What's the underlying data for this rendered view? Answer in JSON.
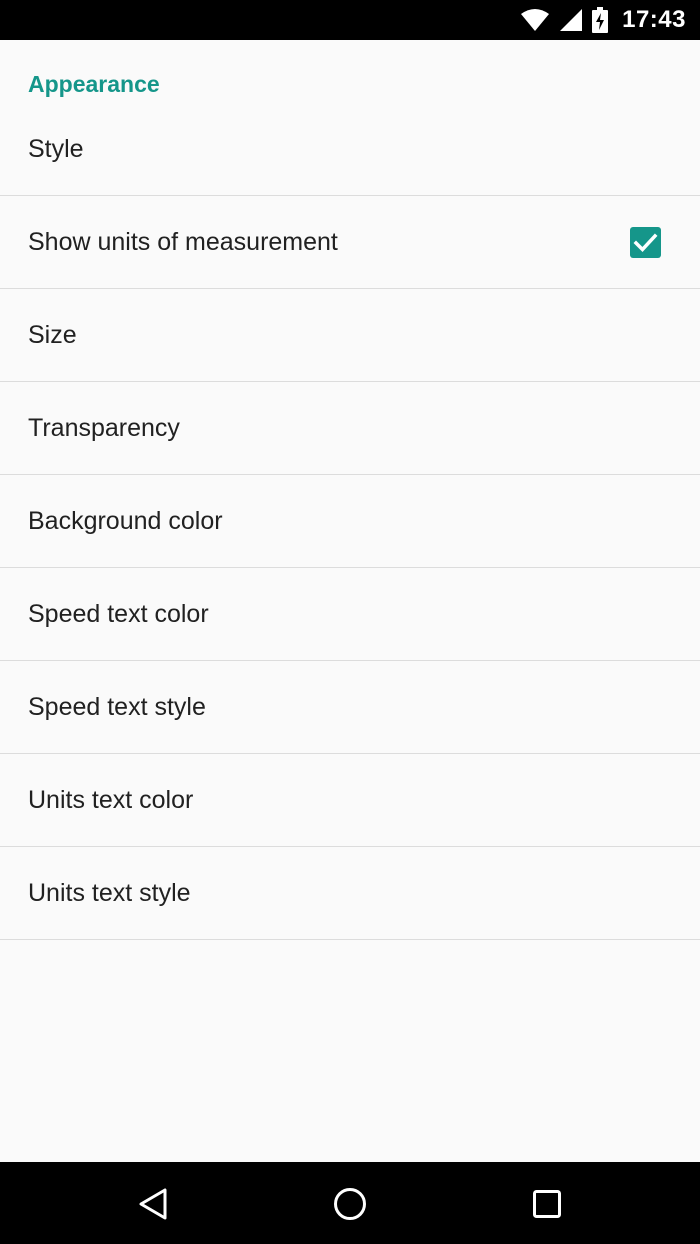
{
  "status_bar": {
    "time": "17:43",
    "icons": [
      "wifi-icon",
      "cell-signal-icon",
      "battery-charging-icon"
    ]
  },
  "settings": {
    "category_title": "Appearance",
    "items": [
      {
        "label": "Style"
      },
      {
        "label": "Show units of measurement",
        "checked": true
      },
      {
        "label": "Size"
      },
      {
        "label": "Transparency"
      },
      {
        "label": "Background color"
      },
      {
        "label": "Speed text color"
      },
      {
        "label": "Speed text style"
      },
      {
        "label": "Units text color"
      },
      {
        "label": "Units text style"
      }
    ]
  },
  "nav_bar": {
    "buttons": [
      "back-icon",
      "home-icon",
      "recents-icon"
    ]
  },
  "colors": {
    "accent": "#15968a",
    "background": "#fafafa",
    "text": "#212121",
    "divider": "#dcdcdc"
  }
}
